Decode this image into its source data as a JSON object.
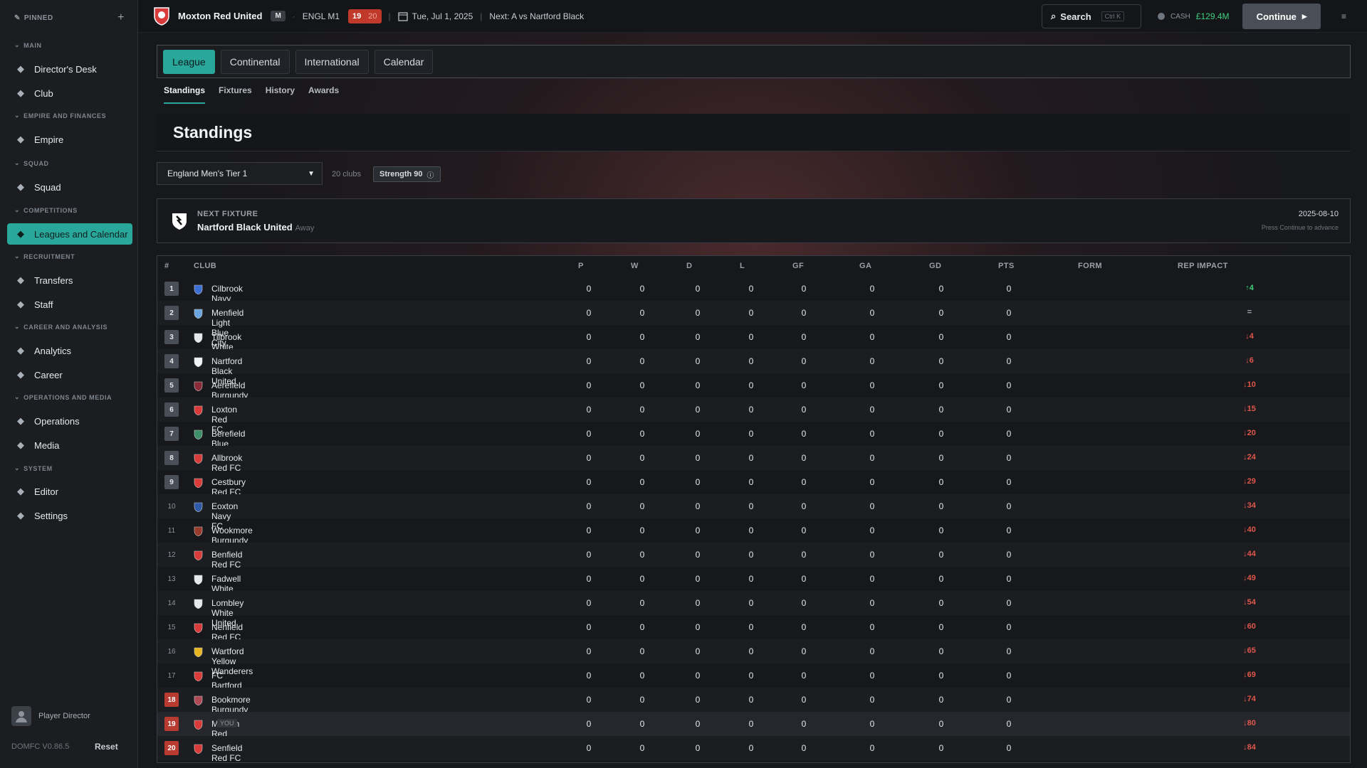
{
  "sidebar": {
    "pinned": "PINNED",
    "sections": [
      {
        "title": "MAIN",
        "items": [
          {
            "label": "Director's Desk",
            "icon": "clipboard-icon"
          },
          {
            "label": "Club",
            "icon": "map-pin-icon"
          }
        ]
      },
      {
        "title": "EMPIRE AND FINANCES",
        "items": [
          {
            "label": "Empire",
            "icon": "gear-icon"
          }
        ]
      },
      {
        "title": "SQUAD",
        "items": [
          {
            "label": "Squad",
            "icon": "users-icon"
          }
        ]
      },
      {
        "title": "COMPETITIONS",
        "items": [
          {
            "label": "Leagues and Calendar",
            "icon": "list-icon",
            "active": true
          }
        ]
      },
      {
        "title": "RECRUITMENT",
        "items": [
          {
            "label": "Transfers",
            "icon": "arrows-icon"
          },
          {
            "label": "Staff",
            "icon": "staff-icon"
          }
        ]
      },
      {
        "title": "CAREER AND ANALYSIS",
        "items": [
          {
            "label": "Analytics",
            "icon": "bar-chart-icon"
          },
          {
            "label": "Career",
            "icon": "person-icon"
          }
        ]
      },
      {
        "title": "OPERATIONS AND MEDIA",
        "items": [
          {
            "label": "Operations",
            "icon": "building-icon"
          },
          {
            "label": "Media",
            "icon": "media-icon"
          }
        ]
      },
      {
        "title": "SYSTEM",
        "items": [
          {
            "label": "Editor",
            "icon": "pencil-icon"
          },
          {
            "label": "Settings",
            "icon": "cog-icon"
          }
        ]
      }
    ],
    "user": "Player Director",
    "version": "DOMFC V0.86.5",
    "reset": "Reset"
  },
  "topbar": {
    "club": "Moxton Red United",
    "mode": "M",
    "league": "ENGL M1",
    "position": "19",
    "position_of": "20",
    "date": "Tue, Jul 1, 2025",
    "next": "Next: A  vs Nartford Black",
    "search": "Search",
    "shortcut": "Ctrl K",
    "cash_label": "CASH",
    "cash_value": "£129.4M",
    "continue": "Continue"
  },
  "tabs": [
    "League",
    "Continental",
    "International",
    "Calendar"
  ],
  "subtabs": [
    "Standings",
    "Fixtures",
    "History",
    "Awards"
  ],
  "page_title": "Standings",
  "league_select": "England Men's Tier 1",
  "clubs_count": "20 clubs",
  "strength": "Strength 90",
  "fixture": {
    "label": "NEXT FIXTURE",
    "team": "Nartford Black United",
    "location": "Away",
    "date": "2025-08-10",
    "hint": "Press Continue to advance"
  },
  "table": {
    "headers": [
      "#",
      "CLUB",
      "P",
      "W",
      "D",
      "L",
      "GF",
      "GA",
      "GD",
      "PTS",
      "FORM",
      "REP IMPACT"
    ],
    "rows": [
      {
        "pos": "1",
        "club": "Cilbrook Navy FC",
        "p": "0",
        "w": "0",
        "d": "0",
        "l": "0",
        "gf": "0",
        "ga": "0",
        "gd": "0",
        "pts": "0",
        "form": "",
        "rep": "↑4",
        "trend": "up",
        "color": "#3b6fd6"
      },
      {
        "pos": "2",
        "club": "Menfield Light Blue City",
        "p": "0",
        "w": "0",
        "d": "0",
        "l": "0",
        "gf": "0",
        "ga": "0",
        "gd": "0",
        "pts": "0",
        "form": "",
        "rep": "=",
        "trend": "eq",
        "color": "#6aa6e0"
      },
      {
        "pos": "3",
        "club": "Tilbrook White FC",
        "p": "0",
        "w": "0",
        "d": "0",
        "l": "0",
        "gf": "0",
        "ga": "0",
        "gd": "0",
        "pts": "0",
        "form": "",
        "rep": "↓4",
        "trend": "down",
        "color": "#e6e8ea"
      },
      {
        "pos": "4",
        "club": "Nartford Black United",
        "p": "0",
        "w": "0",
        "d": "0",
        "l": "0",
        "gf": "0",
        "ga": "0",
        "gd": "0",
        "pts": "0",
        "form": "",
        "rep": "↓6",
        "trend": "down",
        "color": "#f2f3f4"
      },
      {
        "pos": "5",
        "club": "Aerefield Burgundy FC",
        "p": "0",
        "w": "0",
        "d": "0",
        "l": "0",
        "gf": "0",
        "ga": "0",
        "gd": "0",
        "pts": "0",
        "form": "",
        "rep": "↓10",
        "trend": "down",
        "color": "#8a2b3a"
      },
      {
        "pos": "6",
        "club": "Loxton Red FC",
        "p": "0",
        "w": "0",
        "d": "0",
        "l": "0",
        "gf": "0",
        "ga": "0",
        "gd": "0",
        "pts": "0",
        "form": "",
        "rep": "↓15",
        "trend": "down",
        "color": "#d93a3a"
      },
      {
        "pos": "7",
        "club": "Berefield Blue Albion",
        "p": "0",
        "w": "0",
        "d": "0",
        "l": "0",
        "gf": "0",
        "ga": "0",
        "gd": "0",
        "pts": "0",
        "form": "",
        "rep": "↓20",
        "trend": "down",
        "color": "#3d8f6a"
      },
      {
        "pos": "8",
        "club": "Allbrook Red FC",
        "p": "0",
        "w": "0",
        "d": "0",
        "l": "0",
        "gf": "0",
        "ga": "0",
        "gd": "0",
        "pts": "0",
        "form": "",
        "rep": "↓24",
        "trend": "down",
        "color": "#d93a3a"
      },
      {
        "pos": "9",
        "club": "Cestbury Red FC",
        "p": "0",
        "w": "0",
        "d": "0",
        "l": "0",
        "gf": "0",
        "ga": "0",
        "gd": "0",
        "pts": "0",
        "form": "",
        "rep": "↓29",
        "trend": "down",
        "color": "#d93a3a"
      },
      {
        "pos": "10",
        "club": "Eoxton Navy FC",
        "p": "0",
        "w": "0",
        "d": "0",
        "l": "0",
        "gf": "0",
        "ga": "0",
        "gd": "0",
        "pts": "0",
        "form": "",
        "rep": "↓34",
        "trend": "down",
        "color": "#2f5aa8"
      },
      {
        "pos": "11",
        "club": "Wookmore Burgundy United",
        "p": "0",
        "w": "0",
        "d": "0",
        "l": "0",
        "gf": "0",
        "ga": "0",
        "gd": "0",
        "pts": "0",
        "form": "",
        "rep": "↓40",
        "trend": "down",
        "color": "#9a3a2a"
      },
      {
        "pos": "12",
        "club": "Benfield Red FC",
        "p": "0",
        "w": "0",
        "d": "0",
        "l": "0",
        "gf": "0",
        "ga": "0",
        "gd": "0",
        "pts": "0",
        "form": "",
        "rep": "↓44",
        "trend": "down",
        "color": "#d93a3a"
      },
      {
        "pos": "13",
        "club": "Fadwell White FC",
        "p": "0",
        "w": "0",
        "d": "0",
        "l": "0",
        "gf": "0",
        "ga": "0",
        "gd": "0",
        "pts": "0",
        "form": "",
        "rep": "↓49",
        "trend": "down",
        "color": "#e6e8ea"
      },
      {
        "pos": "14",
        "club": "Lombley White United",
        "p": "0",
        "w": "0",
        "d": "0",
        "l": "0",
        "gf": "0",
        "ga": "0",
        "gd": "0",
        "pts": "0",
        "form": "",
        "rep": "↓54",
        "trend": "down",
        "color": "#e6e8ea"
      },
      {
        "pos": "15",
        "club": "Nenfield Red FC",
        "p": "0",
        "w": "0",
        "d": "0",
        "l": "0",
        "gf": "0",
        "ga": "0",
        "gd": "0",
        "pts": "0",
        "form": "",
        "rep": "↓60",
        "trend": "down",
        "color": "#d93a3a"
      },
      {
        "pos": "16",
        "club": "Wartford Yellow Wanderers",
        "p": "0",
        "w": "0",
        "d": "0",
        "l": "0",
        "gf": "0",
        "ga": "0",
        "gd": "0",
        "pts": "0",
        "form": "",
        "rep": "↓65",
        "trend": "down",
        "color": "#e8b420"
      },
      {
        "pos": "17",
        "club": "FC Bartford Red",
        "p": "0",
        "w": "0",
        "d": "0",
        "l": "0",
        "gf": "0",
        "ga": "0",
        "gd": "0",
        "pts": "0",
        "form": "",
        "rep": "↓69",
        "trend": "down",
        "color": "#d93a3a"
      },
      {
        "pos": "18",
        "club": "Bookmore Burgundy FC",
        "p": "0",
        "w": "0",
        "d": "0",
        "l": "0",
        "gf": "0",
        "ga": "0",
        "gd": "0",
        "pts": "0",
        "form": "",
        "rep": "↓74",
        "trend": "down",
        "color": "#b04a55"
      },
      {
        "pos": "19",
        "club": "Moxton Red United",
        "you": "YOU",
        "p": "0",
        "w": "0",
        "d": "0",
        "l": "0",
        "gf": "0",
        "ga": "0",
        "gd": "0",
        "pts": "0",
        "form": "",
        "rep": "↓80",
        "trend": "down",
        "color": "#d93a3a"
      },
      {
        "pos": "20",
        "club": "Senfield Red FC",
        "p": "0",
        "w": "0",
        "d": "0",
        "l": "0",
        "gf": "0",
        "ga": "0",
        "gd": "0",
        "pts": "0",
        "form": "",
        "rep": "↓84",
        "trend": "down",
        "color": "#d93a3a"
      }
    ]
  }
}
